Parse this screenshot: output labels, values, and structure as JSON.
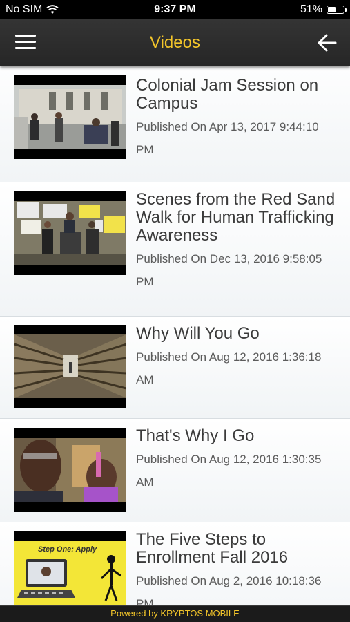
{
  "status_bar": {
    "carrier": "No SIM",
    "time": "9:37 PM",
    "battery_text": "51%",
    "battery_level": 0.51
  },
  "header": {
    "title": "Videos",
    "menu_icon": "hamburger-menu-icon",
    "back_icon": "arrow-left-icon"
  },
  "videos": [
    {
      "title": "Colonial Jam Session on Campus",
      "published": "Published On Apr 13, 2017 9:44:10 PM"
    },
    {
      "title": "Scenes from the Red Sand Walk for Human Trafficking Awareness",
      "published": "Published On Dec 13, 2016 9:58:05 PM"
    },
    {
      "title": "Why Will You Go",
      "published": "Published On Aug 12, 2016 1:36:18 AM"
    },
    {
      "title": "That's Why I Go",
      "published": "Published On Aug 12, 2016 1:30:35 AM"
    },
    {
      "title": "The Five Steps to Enrollment Fall 2016",
      "published": "Published On Aug 2, 2016 10:18:36 PM",
      "thumbnail_caption": "Step One: Apply"
    }
  ],
  "footer": {
    "text": "Powered by KRYPTOS MOBILE"
  },
  "colors": {
    "accent": "#f3c52a",
    "header_bg": "#2e2e2e",
    "title_text": "#3b3b3b"
  }
}
